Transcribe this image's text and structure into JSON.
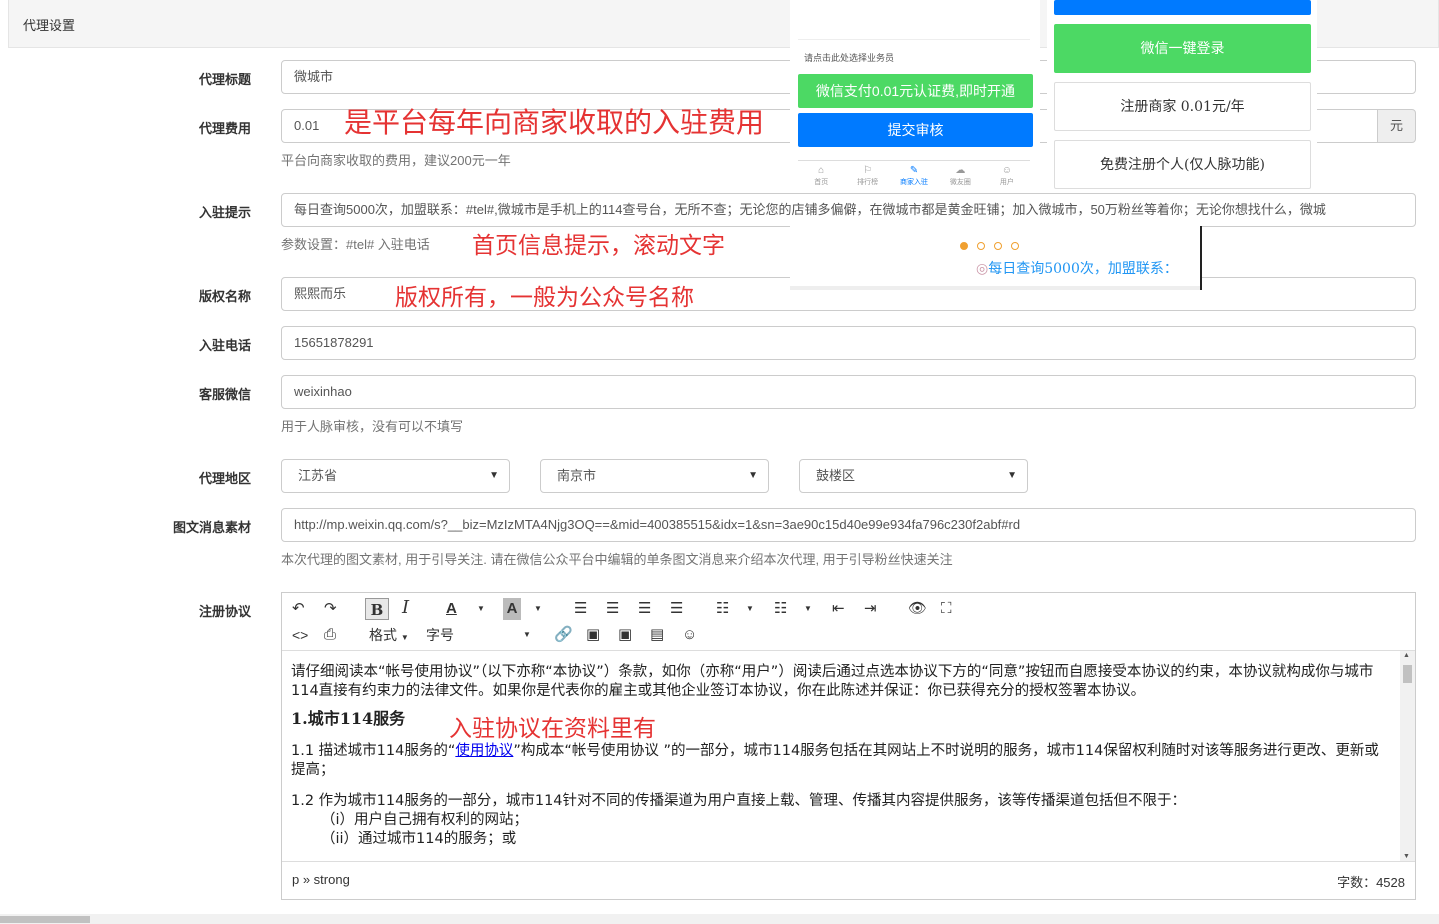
{
  "panel": {
    "title": "代理设置"
  },
  "form": {
    "title": {
      "label": "代理标题",
      "value": "微城市"
    },
    "fee": {
      "label": "代理费用",
      "value": "0.01",
      "unit": "元",
      "help": "平台向商家收取的费用，建议200元一年"
    },
    "tip": {
      "label": "入驻提示",
      "value": "每日查询5000次，加盟联系：#tel#,微城市是手机上的114查号台，无所不查；无论您的店铺多偏僻，在微城市都是黄金旺铺；加入微城市，50万粉丝等着你；无论你想找什么，微城",
      "help": "参数设置：#tel# 入驻电话"
    },
    "copyright": {
      "label": "版权名称",
      "value": "熙熙而乐"
    },
    "phone": {
      "label": "入驻电话",
      "value": "15651878291"
    },
    "wechat": {
      "label": "客服微信",
      "value": "weixinhao",
      "help": "用于人脉审核，没有可以不填写"
    },
    "region": {
      "label": "代理地区",
      "province": "江苏省",
      "city": "南京市",
      "district": "鼓楼区"
    },
    "material": {
      "label": "图文消息素材",
      "value": "http://mp.weixin.qq.com/s?__biz=MzIzMTA4Njg3OQ==&mid=400385515&idx=1&sn=3ae90c15d40e99e934fa796c230f2abf#rd",
      "help": "本次代理的图文素材, 用于引导关注. 请在微信公众平台中编辑的单条图文消息来介绍本次代理, 用于引导粉丝快速关注"
    },
    "agreement": {
      "label": "注册协议"
    }
  },
  "annotations": {
    "fee": "是平台每年向商家收取的入驻费用",
    "tip": "首页信息提示，滚动文字",
    "copyright": "版权所有，一般为公众号名称",
    "agreement": "入驻协议在资料里有"
  },
  "preview": {
    "select_tip": "请点击此处选择业务员",
    "pay_button": "微信支付0.01元认证费,即时开通",
    "submit_button": "提交审核",
    "tabs": [
      {
        "label": "首页",
        "icon": "⌂"
      },
      {
        "label": "排行榜",
        "icon": "⚐"
      },
      {
        "label": "商家入驻",
        "icon": "✎"
      },
      {
        "label": "微友圈",
        "icon": "☁"
      },
      {
        "label": "用户",
        "icon": "☺"
      }
    ],
    "login_button": "微信一键登录",
    "register_merchant": "注册商家 0.01元/年",
    "register_personal": "免费注册个人(仅人脉功能)",
    "marquee": "每日查询5000次，加盟联系："
  },
  "editor": {
    "format_label": "格式",
    "font_size_label": "字号",
    "paragraph1": "请仔细阅读本“帐号使用协议”（以下亦称“本协议”）条款，如你（亦称“用户”）阅读后通过点选本协议下方的“同意”按钮而自愿接受本协议的约束，本协议就构成你与城市114直接有约束力的法律文件。如果你是代表你的雇主或其他企业签订本协议，你在此陈述并保证：你已获得充分的授权签署本协议。",
    "heading": "1.城市114服务",
    "p11_a": "1.1 描述城市114服务的“",
    "p11_link": "使用协议",
    "p11_b": "”构成本“帐号使用协议 ”的一部分，城市114服务包括在其网站上不时说明的服务，城市114保留权利随时对该等服务进行更改、更新或提高；",
    "p12": "1.2 作为城市114服务的一部分，城市114针对不同的传播渠道为用户直接上载、管理、传播其内容提供服务，该等传播渠道包括但不限于：",
    "p12_i": "（i）用户自己拥有权利的网站；",
    "p12_ii": "（ii）通过城市114的服务；或",
    "path": "p » strong",
    "word_count": "字数：4528"
  }
}
